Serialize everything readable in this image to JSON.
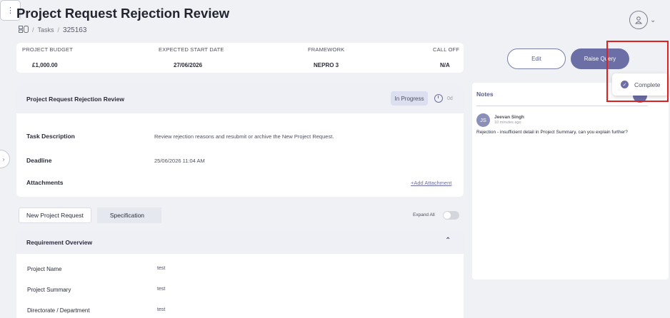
{
  "page": {
    "title": "Project Request Rejection Review"
  },
  "breadcrumb": {
    "icon": "board-icon",
    "section": "Tasks",
    "separator": "/",
    "task_id": "325163"
  },
  "summary": {
    "columns": [
      {
        "label": "PROJECT BUDGET",
        "value": "£1,000.00"
      },
      {
        "label": "EXPECTED START DATE",
        "value": "27/06/2026"
      },
      {
        "label": "FRAMEWORK",
        "value": "NEPRO 3"
      },
      {
        "label": "CALL OFF",
        "value": "N/A"
      }
    ]
  },
  "actions": {
    "edit": "Edit",
    "raise_query": "Raise Query",
    "more": "⋮"
  },
  "menu": {
    "complete": "Complete"
  },
  "notes": {
    "title": "Notes",
    "entries": [
      {
        "initials": "JS",
        "author": "Jeevan Singh",
        "time": "10 minutes ago",
        "text": "Rejection - insufficient detail in Project Summary, can you explain further?"
      }
    ]
  },
  "task": {
    "title": "Project Request Rejection Review",
    "status": "In Progress",
    "days": "0d",
    "rows": [
      {
        "label": "Task Description",
        "value": "Review rejection reasons and resubmit or archive the New Project Request."
      },
      {
        "label": "Deadline",
        "value": "25/06/2026 11:04 AM"
      },
      {
        "label": "Attachments",
        "value": ""
      }
    ],
    "add_attachment": "+Add Attachment"
  },
  "tabs": {
    "items": [
      "New Project Request",
      "Specification"
    ],
    "expand_all": "Expand All"
  },
  "requirement": {
    "title": "Requirement Overview",
    "rows": [
      {
        "label": "Project Name",
        "value": "test"
      },
      {
        "label": "Project Summary",
        "value": "test"
      },
      {
        "label": "Directorate / Department",
        "value": "test"
      }
    ]
  },
  "colors": {
    "accent": "#6b6fa5",
    "highlight": "#e02020",
    "background": "#f0f1f4"
  }
}
